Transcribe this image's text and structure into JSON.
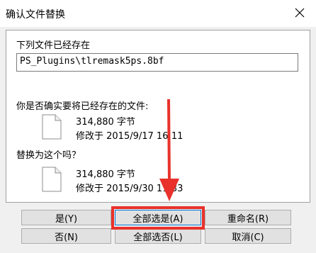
{
  "window": {
    "title": "确认文件替换"
  },
  "dialog": {
    "existing_heading": "下列文件已经存在",
    "file_path": "PS_Plugins\\tlremask5ps.8bf",
    "replace_question": "你是否确实要将已经存在的文件:",
    "existing_file": {
      "size": "314,880 字节",
      "modified": "修改于 2015/9/17 16:11"
    },
    "with_question": "替换为这个吗？",
    "new_file": {
      "size": "314,880 字节",
      "modified": "修改于 2015/9/30 11:33"
    }
  },
  "buttons": {
    "yes": "是(Y)",
    "yes_all": "全部选是(A)",
    "rename": "重命名(R)",
    "no": "否(N)",
    "no_all": "全部选否(L)",
    "cancel": "取消(C)"
  },
  "annotation_color": "#e8322b"
}
